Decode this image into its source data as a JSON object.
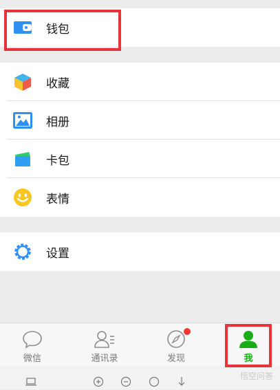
{
  "wallet": {
    "label": "钱包",
    "icon": "wallet-icon"
  },
  "menu": {
    "items": [
      {
        "label": "收藏",
        "icon": "favorites-cube-icon"
      },
      {
        "label": "相册",
        "icon": "album-picture-icon"
      },
      {
        "label": "卡包",
        "icon": "card-wallet-icon"
      },
      {
        "label": "表情",
        "icon": "smiley-icon"
      }
    ]
  },
  "settings": {
    "label": "设置",
    "icon": "gear-icon"
  },
  "tabbar": {
    "tabs": [
      {
        "label": "微信",
        "icon": "chat-bubble-icon",
        "active": false
      },
      {
        "label": "通讯录",
        "icon": "contacts-icon",
        "active": false
      },
      {
        "label": "发现",
        "icon": "compass-icon",
        "active": false,
        "badge": true
      },
      {
        "label": "我",
        "icon": "person-icon",
        "active": true
      }
    ]
  },
  "browser": {
    "icons": [
      "laptop-icon",
      "zoom-in-icon",
      "zoom-out-icon",
      "chat-icon",
      "download-icon"
    ]
  },
  "watermark": "悟空问答",
  "colors": {
    "accent": "#1aad19",
    "highlight": "#e8333a",
    "badge": "#f43530"
  }
}
